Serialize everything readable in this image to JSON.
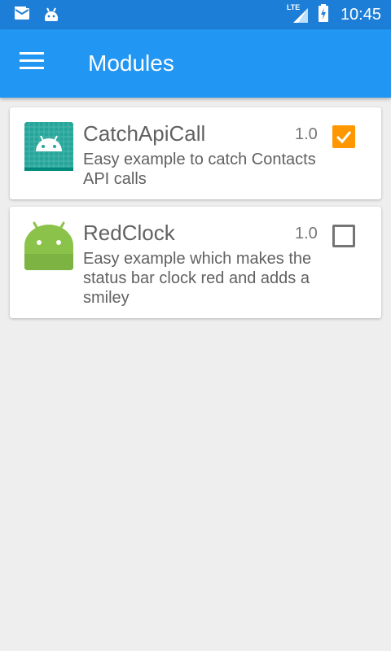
{
  "status_bar": {
    "time": "10:45",
    "network": "LTE",
    "icons": [
      "mail-icon",
      "android-notification-icon",
      "signal-icon",
      "battery-charging-icon"
    ]
  },
  "app_bar": {
    "title": "Modules",
    "menu_icon": "hamburger-menu-icon"
  },
  "modules": [
    {
      "name": "CatchApiCall",
      "description": "Easy example to catch Contacts API calls",
      "version": "1.0",
      "enabled": true,
      "icon": "android-grid-icon",
      "icon_color": "#26a69a"
    },
    {
      "name": "RedClock",
      "description": "Easy example which makes the status bar clock red and adds a smiley",
      "version": "1.0",
      "enabled": false,
      "icon": "android-robot-icon",
      "icon_color": "#8bc34a"
    }
  ],
  "colors": {
    "status_bar": "#1c7ed6",
    "app_bar": "#2196f3",
    "background": "#eeeeee",
    "checkbox_checked": "#ff9800",
    "checkbox_unchecked": "#757575"
  }
}
